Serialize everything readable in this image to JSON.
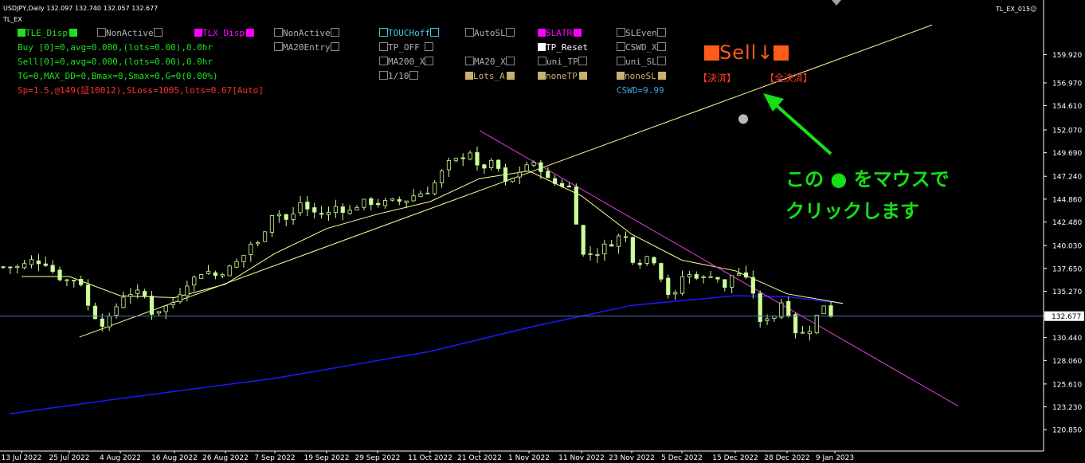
{
  "window": {
    "symbol_header": "USDJPY,Daily  132.097 132.740 132.057 132.677",
    "indicator_name": "TL_EX",
    "right_label": "TL_EX_015☺"
  },
  "panel": {
    "tle_disp": "TLE_Disp",
    "nonactive_1": "NonActive",
    "tlx_disp": "TLX_Disp",
    "nonactive_2": "NonActive",
    "touchoff": "TOUCHoff",
    "autosl": "AutoSL",
    "slatr": "SLATR",
    "sleven": "SLEven",
    "buy_line": "Buy [0]=0,avg=0.000,(lots=0.00),0.0hr",
    "sell_line": "Sell[0]=0,avg=0.000,(lots=0.00),0.0hr",
    "tg_line": "TG=0,MAX_DD=0,Bmax=0,Smax=0,G=0(0.00%)",
    "sp_line": "Sp=1.5,@149(証10012),SLoss=1005,lots=0.67[Auto]",
    "ma20entry": "MA20Entry",
    "tp_off": "TP_OFF",
    "tp_reset": "TP_Reset",
    "cswd_x": "CSWD_X",
    "ma200_x": "MA200_X",
    "ma20_x": "MA20_X",
    "uni_tp": "uni_TP",
    "uni_sl": "uni_SL",
    "one_tenth": "1/10",
    "lots_a": "Lots_A",
    "nonetp": "noneTP",
    "nonesl": "noneSL",
    "cswd_val": "CSWD=9.99"
  },
  "trade": {
    "sell_label": "Sell",
    "arrow": "↓",
    "settle": "【決済】",
    "settle_all": "【全決済】"
  },
  "annotation": {
    "line1": "この ● をマウスで",
    "line2": "クリックします"
  },
  "colors": {
    "bg": "#000000",
    "candle": "#ccff99",
    "ma20": "#ffff99",
    "ma200": "#1a1aff",
    "uptrend": "#ffff99",
    "downtrend": "#e040e0",
    "price_line": "#4a6fb0",
    "green_text": "#22dd22",
    "magenta": "#ff00ff",
    "cyan": "#40c8e0",
    "red": "#ff3030",
    "gray": "#b0b0b0",
    "tan": "#c8b070",
    "annotation": "#16e016"
  },
  "chart_data": {
    "type": "candlestick",
    "symbol": "USDJPY",
    "timeframe": "Daily",
    "ohlc_header": {
      "open": 132.097,
      "high": 132.74,
      "low": 132.057,
      "close": 132.677
    },
    "current_price": 132.677,
    "y_ticks": [
      159.92,
      156.97,
      154.61,
      152.07,
      149.69,
      147.24,
      144.86,
      142.48,
      140.03,
      137.65,
      135.27,
      132.677,
      130.44,
      128.06,
      125.61,
      123.23,
      120.85
    ],
    "x_ticks": [
      "13 Jul 2022",
      "25 Jul 2022",
      "4 Aug 2022",
      "16 Aug 2022",
      "26 Aug 2022",
      "7 Sep 2022",
      "19 Sep 2022",
      "29 Sep 2022",
      "11 Oct 2022",
      "21 Oct 2022",
      "1 Nov 2022",
      "11 Nov 2022",
      "23 Nov 2022",
      "5 Dec 2022",
      "15 Dec 2022",
      "28 Dec 2022",
      "9 Jan 2023"
    ],
    "ylim": [
      120.0,
      162.0
    ],
    "close_path": [
      [
        "13 Jul 2022",
        137.8
      ],
      [
        "15 Jul 2022",
        138.5
      ],
      [
        "19 Jul 2022",
        138.2
      ],
      [
        "21 Jul 2022",
        137.3
      ],
      [
        "23 Jul 2022",
        136.5
      ],
      [
        "25 Jul 2022",
        136.4
      ],
      [
        "27 Jul 2022",
        136.6
      ],
      [
        "29 Jul 2022",
        133.2
      ],
      [
        "1 Aug 2022",
        131.6
      ],
      [
        "3 Aug 2022",
        133.5
      ],
      [
        "5 Aug 2022",
        135.0
      ],
      [
        "9 Aug 2022",
        135.2
      ],
      [
        "11 Aug 2022",
        133.0
      ],
      [
        "13 Aug 2022",
        133.4
      ],
      [
        "16 Aug 2022",
        134.2
      ],
      [
        "18 Aug 2022",
        135.9
      ],
      [
        "22 Aug 2022",
        137.5
      ],
      [
        "24 Aug 2022",
        136.9
      ],
      [
        "26 Aug 2022",
        137.4
      ],
      [
        "30 Aug 2022",
        138.7
      ],
      [
        "1 Sep 2022",
        140.2
      ],
      [
        "3 Sep 2022",
        140.2
      ],
      [
        "7 Sep 2022",
        144.0
      ],
      [
        "9 Sep 2022",
        142.6
      ],
      [
        "11 Sep 2022",
        143.0
      ],
      [
        "13 Sep 2022",
        144.6
      ],
      [
        "15 Sep 2022",
        143.6
      ],
      [
        "19 Sep 2022",
        143.2
      ],
      [
        "21 Sep 2022",
        144.2
      ],
      [
        "23 Sep 2022",
        143.4
      ],
      [
        "26 Sep 2022",
        144.6
      ],
      [
        "29 Sep 2022",
        144.4
      ],
      [
        "3 Oct 2022",
        144.7
      ],
      [
        "5 Oct 2022",
        144.6
      ],
      [
        "7 Oct 2022",
        145.2
      ],
      [
        "11 Oct 2022",
        145.8
      ],
      [
        "13 Oct 2022",
        147.4
      ],
      [
        "15 Oct 2022",
        148.8
      ],
      [
        "17 Oct 2022",
        149.0
      ],
      [
        "19 Oct 2022",
        149.9
      ],
      [
        "21 Oct 2022",
        147.6
      ],
      [
        "23 Oct 2022",
        148.8
      ],
      [
        "25 Oct 2022",
        148.2
      ],
      [
        "27 Oct 2022",
        146.3
      ],
      [
        "29 Oct 2022",
        147.3
      ],
      [
        "1 Nov 2022",
        148.7
      ],
      [
        "3 Nov 2022",
        148.2
      ],
      [
        "5 Nov 2022",
        146.6
      ],
      [
        "7 Nov 2022",
        146.4
      ],
      [
        "9 Nov 2022",
        146.0
      ],
      [
        "11 Nov 2022",
        139.0
      ],
      [
        "13 Nov 2022",
        139.2
      ],
      [
        "15 Nov 2022",
        139.3
      ],
      [
        "17 Nov 2022",
        140.2
      ],
      [
        "19 Nov 2022",
        140.3
      ],
      [
        "21 Nov 2022",
        141.8
      ],
      [
        "23 Nov 2022",
        138.6
      ],
      [
        "25 Nov 2022",
        138.3
      ],
      [
        "27 Nov 2022",
        139.0
      ],
      [
        "29 Nov 2022",
        138.2
      ],
      [
        "1 Dec 2022",
        135.4
      ],
      [
        "3 Dec 2022",
        134.4
      ],
      [
        "5 Dec 2022",
        136.8
      ],
      [
        "7 Dec 2022",
        137.0
      ],
      [
        "9 Dec 2022",
        136.6
      ],
      [
        "11 Dec 2022",
        137.2
      ],
      [
        "13 Dec 2022",
        135.5
      ],
      [
        "15 Dec 2022",
        137.6
      ],
      [
        "17 Dec 2022",
        136.6
      ],
      [
        "19 Dec 2022",
        136.2
      ],
      [
        "21 Dec 2022",
        131.8
      ],
      [
        "23 Dec 2022",
        132.6
      ],
      [
        "25 Dec 2022",
        132.8
      ],
      [
        "27 Dec 2022",
        134.5
      ],
      [
        "28 Dec 2022",
        133.4
      ],
      [
        "30 Dec 2022",
        131.1
      ],
      [
        "2 Jan 2023",
        130.8
      ],
      [
        "4 Jan 2023",
        132.3
      ],
      [
        "6 Jan 2023",
        134.0
      ],
      [
        "9 Jan 2023",
        132.2
      ],
      [
        "11 Jan 2023",
        132.677
      ]
    ],
    "uptrend_line": [
      [
        "27 Jul 2022",
        130.5
      ],
      [
        "17 Dec 2022",
        155.8
      ]
    ],
    "downtrend_line": [
      [
        "21 Oct 2022",
        152.0
      ],
      [
        "9 Feb 2023",
        123.3
      ]
    ],
    "ma20": [
      [
        "13 Jul 2022",
        136.8
      ],
      [
        "25 Jul 2022",
        136.8
      ],
      [
        "4 Aug 2022",
        134.8
      ],
      [
        "16 Aug 2022",
        134.6
      ],
      [
        "26 Aug 2022",
        136.0
      ],
      [
        "7 Sep 2022",
        139.2
      ],
      [
        "19 Sep 2022",
        141.8
      ],
      [
        "29 Sep 2022",
        143.3
      ],
      [
        "11 Oct 2022",
        144.6
      ],
      [
        "21 Oct 2022",
        147.0
      ],
      [
        "1 Nov 2022",
        147.8
      ],
      [
        "11 Nov 2022",
        145.2
      ],
      [
        "23 Nov 2022",
        141.2
      ],
      [
        "5 Dec 2022",
        138.5
      ],
      [
        "15 Dec 2022",
        137.4
      ],
      [
        "28 Dec 2022",
        135.0
      ],
      [
        "11 Jan 2023",
        134.0
      ]
    ],
    "ma200": [
      [
        "10 Jul 2022",
        122.5
      ],
      [
        "4 Aug 2022",
        124.1
      ],
      [
        "7 Sep 2022",
        126.2
      ],
      [
        "11 Oct 2022",
        129.0
      ],
      [
        "1 Nov 2022",
        131.5
      ],
      [
        "23 Nov 2022",
        133.8
      ],
      [
        "15 Dec 2022",
        134.8
      ],
      [
        "28 Dec 2022",
        134.7
      ],
      [
        "11 Jan 2023",
        134.0
      ]
    ],
    "click_target": [
      "17 Dec 2022",
      153.2
    ],
    "legend": "none",
    "grid": false
  }
}
